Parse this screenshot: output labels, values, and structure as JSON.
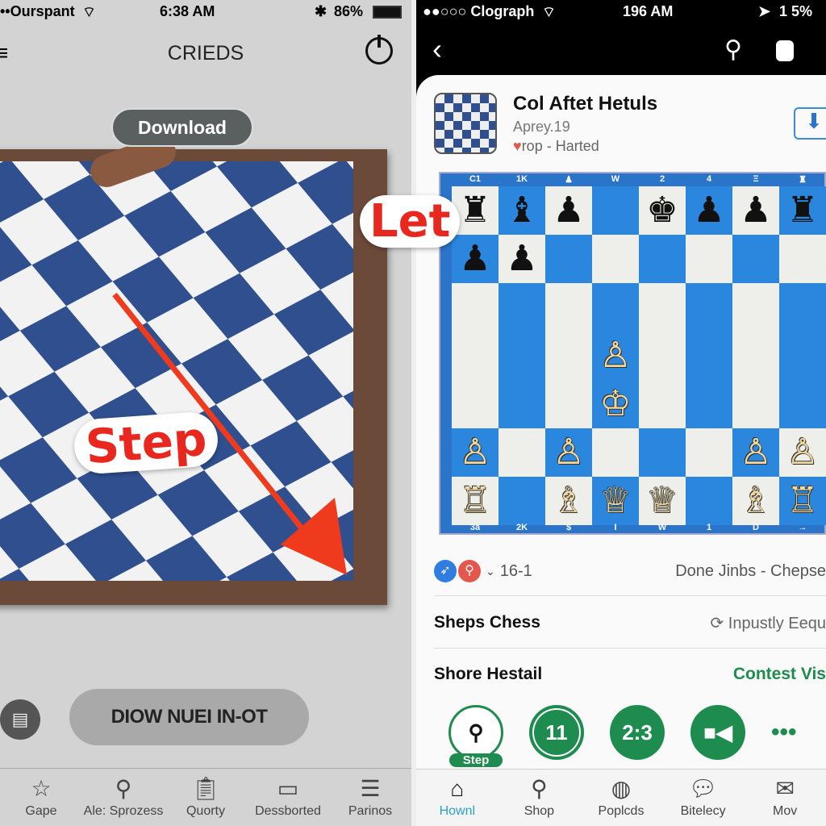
{
  "left": {
    "status": {
      "carrier": "••Ourspant",
      "time": "6:38 AM",
      "battery": "86%"
    },
    "nav": {
      "title": "CRIEDS"
    },
    "download_label": "Download",
    "sticker": "Step",
    "main_button": "DIOW NUEI IN-OT",
    "tabs": [
      {
        "label": "Gape",
        "icon": "star-icon"
      },
      {
        "label": "Ale: Sprozess",
        "icon": "search-icon"
      },
      {
        "label": "Quorty",
        "icon": "clipboard-icon"
      },
      {
        "label": "Dessborted",
        "icon": "board-icon"
      },
      {
        "label": "Parinos",
        "icon": "list-icon"
      }
    ],
    "colors": {
      "flag_blue": "#2f4f8f",
      "arrow_red": "#f03a1e"
    }
  },
  "sticker_center": "Let",
  "right": {
    "status": {
      "carrier": "●●○○○ Clograph",
      "time": "196 AM",
      "battery": "1 5%"
    },
    "app": {
      "title": "Col Aftet Hetuls",
      "subtitle": "Aprey.19",
      "meta": "rop - Harted"
    },
    "board": {
      "top_coords": [
        "C1",
        "1K",
        "♟",
        "W",
        "2",
        "4",
        "Ξ",
        "♜"
      ],
      "bottom_coords": [
        "3a",
        "2K",
        "$",
        "I",
        "W",
        "1",
        "D",
        "→"
      ],
      "pieces": [
        [
          "b♜",
          "b♝",
          "b♟",
          "",
          "b♚",
          "b♟",
          "b♟",
          "b♜"
        ],
        [
          "b♟",
          "b♟",
          "",
          "",
          "",
          "",
          "",
          ""
        ],
        [
          "",
          "",
          "",
          "",
          "",
          "",
          "",
          ""
        ],
        [
          "",
          "",
          "",
          "w♙",
          "",
          "",
          "",
          ""
        ],
        [
          "",
          "",
          "",
          "w♔",
          "",
          "",
          "",
          ""
        ],
        [
          "w♙",
          "",
          "w♙",
          "",
          "",
          "",
          "w♙",
          "w♙"
        ],
        [
          "w♖",
          "",
          "w♗",
          "w♕",
          "w♕",
          "",
          "w♗",
          "w♖"
        ]
      ]
    },
    "score_row": {
      "score": "16-1",
      "right_text": "Done Jinbs - Chepse"
    },
    "row2": {
      "label": "Sheps Chess",
      "right_text": "Inpustly Eequ"
    },
    "row3": {
      "label": "Shore Hestail",
      "link": "Contest Vis"
    },
    "actions": [
      {
        "label": "Step",
        "icon": "person-icon"
      },
      {
        "label": "11"
      },
      {
        "label": "2:3"
      },
      {
        "icon": "video-icon"
      },
      {
        "icon": "more-icon"
      }
    ],
    "tabs": [
      {
        "label": "Hownl",
        "icon": "home-icon",
        "active": true
      },
      {
        "label": "Shop",
        "icon": "search-icon"
      },
      {
        "label": "Poplcds",
        "icon": "globe-icon"
      },
      {
        "label": "Bitelecy",
        "icon": "chat-icon"
      },
      {
        "label": "Mov",
        "icon": "mail-icon"
      }
    ],
    "colors": {
      "accent_green": "#1e8c4e",
      "board_blue": "#2b87dd",
      "tab_active": "#2aa0c8"
    }
  }
}
